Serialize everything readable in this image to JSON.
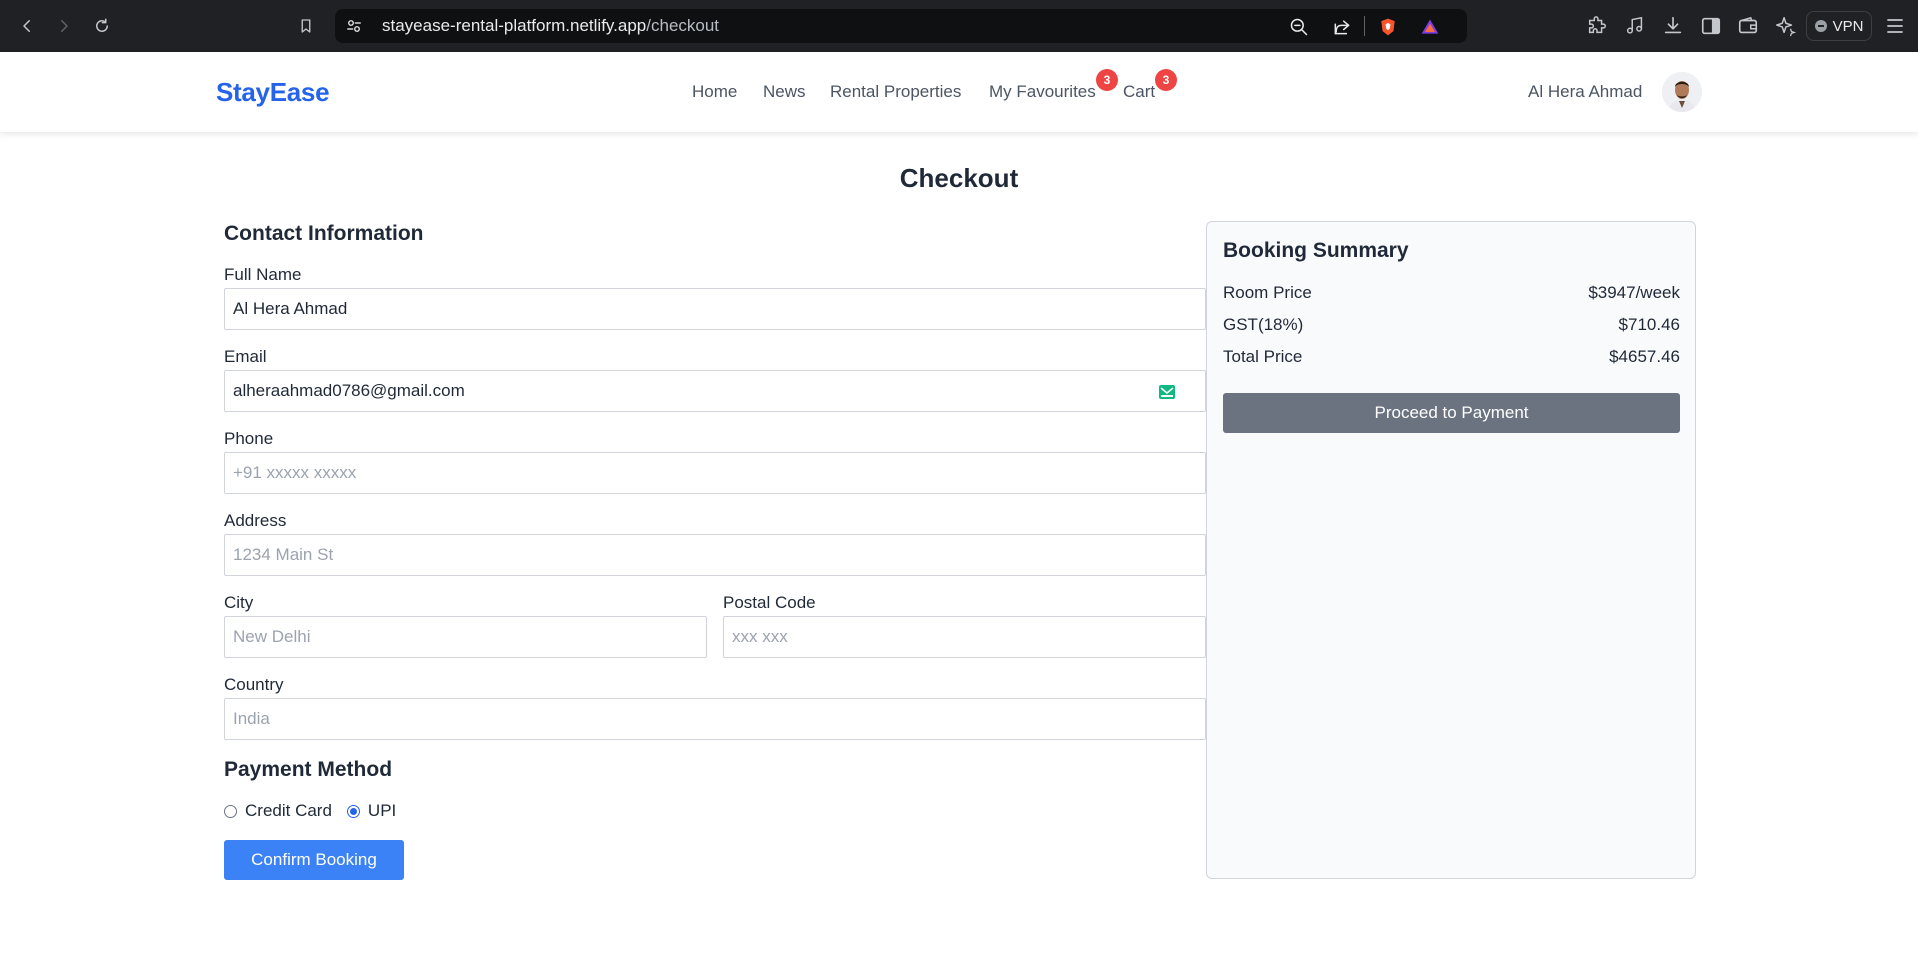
{
  "browser": {
    "url_host": "stayease-rental-platform.netlify.app",
    "url_path": "/checkout",
    "vpn_label": "VPN"
  },
  "header": {
    "logo": "StayEase",
    "nav": [
      {
        "label": "Home"
      },
      {
        "label": "News"
      },
      {
        "label": "Rental Properties"
      },
      {
        "label": "My Favourites",
        "badge": "3"
      },
      {
        "label": "Cart",
        "badge": "3"
      }
    ],
    "user_name": "Al Hera Ahmad"
  },
  "page": {
    "title": "Checkout"
  },
  "contact": {
    "heading": "Contact Information",
    "full_name": {
      "label": "Full Name",
      "value": "Al Hera Ahmad"
    },
    "email": {
      "label": "Email",
      "value": "alheraahmad0786@gmail.com"
    },
    "phone": {
      "label": "Phone",
      "placeholder": "+91 xxxxx xxxxx"
    },
    "address": {
      "label": "Address",
      "placeholder": "1234 Main St"
    },
    "city": {
      "label": "City",
      "placeholder": "New Delhi"
    },
    "postal": {
      "label": "Postal Code",
      "placeholder": "xxx xxx"
    },
    "country": {
      "label": "Country",
      "placeholder": "India"
    }
  },
  "payment": {
    "heading": "Payment Method",
    "options": [
      {
        "label": "Credit Card",
        "selected": false
      },
      {
        "label": "UPI",
        "selected": true
      }
    ],
    "confirm_label": "Confirm Booking"
  },
  "summary": {
    "heading": "Booking Summary",
    "rows": [
      {
        "label": "Room Price",
        "value": "$3947/week"
      },
      {
        "label": "GST(18%)",
        "value": "$710.46"
      },
      {
        "label": "Total Price",
        "value": "$4657.46"
      }
    ],
    "proceed_label": "Proceed to Payment"
  },
  "colors": {
    "accent": "#2563eb",
    "button_primary": "#3b82f6",
    "button_disabled": "#6b7280",
    "badge": "#ef4444"
  }
}
